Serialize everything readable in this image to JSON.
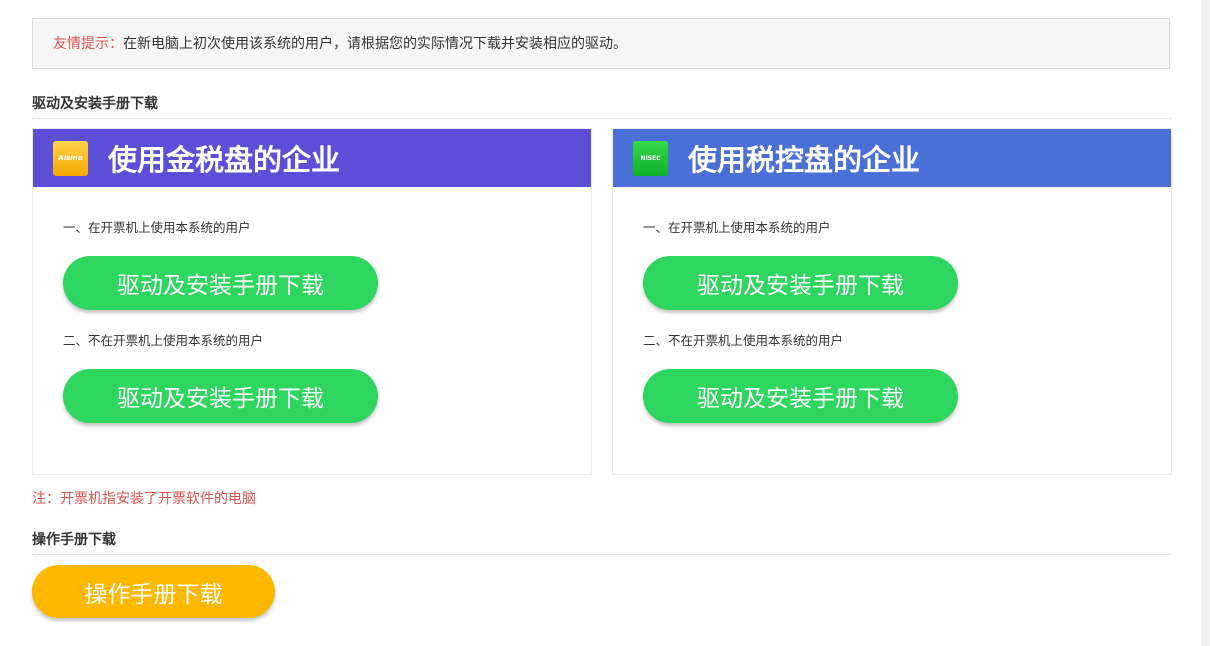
{
  "tip": {
    "label": "友情提示：",
    "text": "在新电脑上初次使用该系统的用户，请根据您的实际情况下载并安装相应的驱动。"
  },
  "section_drivers": {
    "title": "驱动及安装手册下载"
  },
  "panels": [
    {
      "logo_text": "Aisino",
      "title": "使用金税盘的企业",
      "line1": "一、在开票机上使用本系统的用户",
      "button1": "驱动及安装手册下载",
      "line2": "二、不在开票机上使用本系统的用户",
      "button2": "驱动及安装手册下载"
    },
    {
      "logo_text": "NISEC",
      "title": "使用税控盘的企业",
      "line1": "一、在开票机上使用本系统的用户",
      "button1": "驱动及安装手册下载",
      "line2": "二、不在开票机上使用本系统的用户",
      "button2": "驱动及安装手册下载"
    }
  ],
  "note": "注：开票机指安装了开票软件的电脑",
  "section_manual": {
    "title": "操作手册下载",
    "button": "操作手册下载"
  },
  "colors": {
    "panel1_header": "#5a4fd6",
    "panel2_header": "#4a6fd6",
    "green_button": "#2ed65f",
    "yellow_button": "#ffb800",
    "note_red": "#d9534f"
  }
}
